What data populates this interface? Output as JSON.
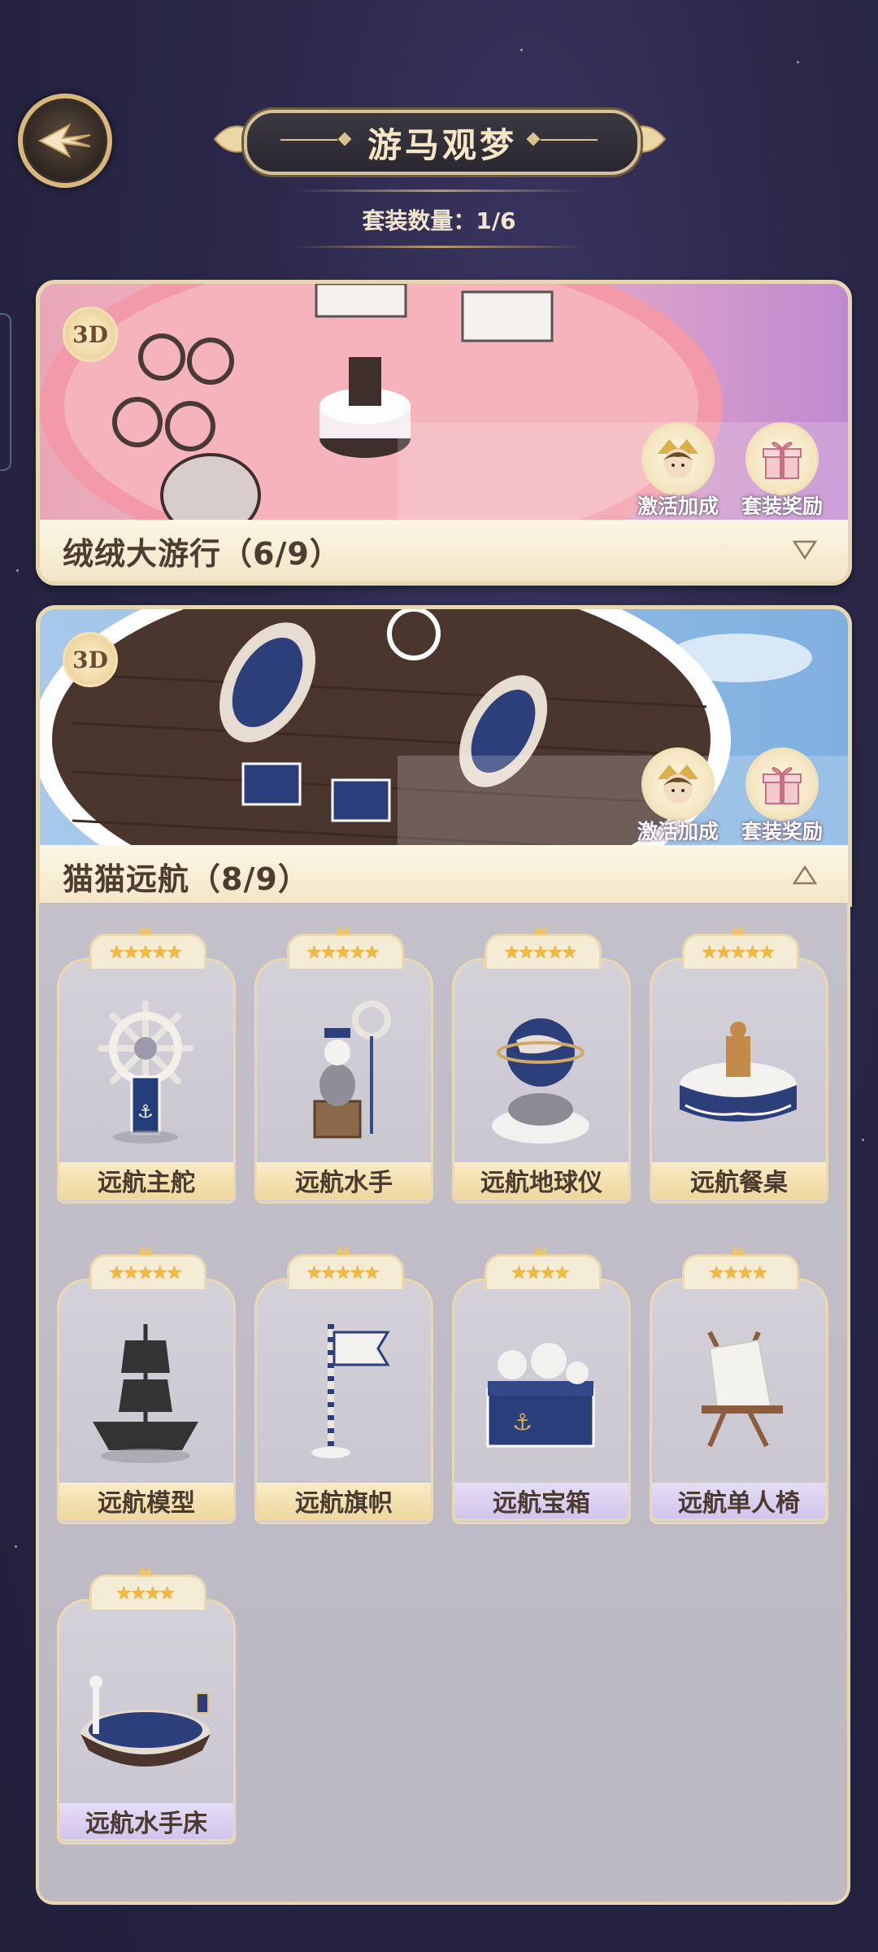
{
  "header": {
    "title": "游马观梦",
    "suit_count": "套装数量：1/6"
  },
  "suits": [
    {
      "badge": "3D",
      "name": "绒绒大游行（6/9）",
      "activate_label": "激活加成",
      "reward_label": "套装奖励",
      "expanded": false
    },
    {
      "badge": "3D",
      "name": "猫猫远航（8/9）",
      "activate_label": "激活加成",
      "reward_label": "套装奖励",
      "expanded": true
    }
  ],
  "items": [
    {
      "name": "远航主舵",
      "stars": 5,
      "rarity_color": "gold",
      "owned": true,
      "icon": "ship-wheel-icon"
    },
    {
      "name": "远航水手",
      "stars": 5,
      "rarity_color": "gold",
      "owned": true,
      "icon": "sailor-cats-icon"
    },
    {
      "name": "远航地球仪",
      "stars": 5,
      "rarity_color": "gold",
      "owned": true,
      "icon": "globe-icon"
    },
    {
      "name": "远航餐桌",
      "stars": 5,
      "rarity_color": "gold",
      "owned": true,
      "icon": "dining-table-icon"
    },
    {
      "name": "远航模型",
      "stars": 5,
      "rarity_color": "gold",
      "owned": false,
      "icon": "ship-model-icon"
    },
    {
      "name": "远航旗帜",
      "stars": 5,
      "rarity_color": "gold",
      "owned": true,
      "icon": "flag-icon"
    },
    {
      "name": "远航宝箱",
      "stars": 4,
      "rarity_color": "purple",
      "owned": true,
      "icon": "treasure-chest-icon"
    },
    {
      "name": "远航单人椅",
      "stars": 4,
      "rarity_color": "purple",
      "owned": true,
      "icon": "deck-chair-icon"
    },
    {
      "name": "远航水手床",
      "stars": 4,
      "rarity_color": "purple",
      "owned": true,
      "icon": "boat-bed-icon"
    }
  ],
  "colors": {
    "gold_label": "#efd79e",
    "purple_label": "#d1c4ec",
    "star": "#f2b93a",
    "accent_border": "#e6d7b0"
  }
}
